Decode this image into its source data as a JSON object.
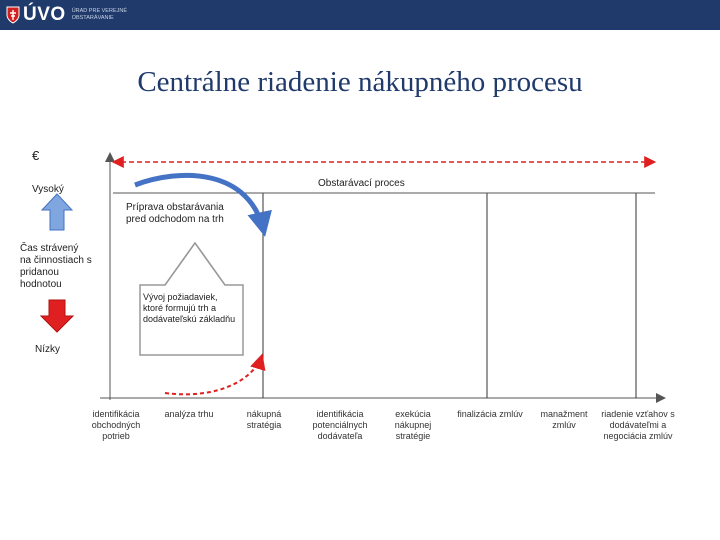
{
  "header": {
    "logo_text": "ÚVO",
    "logo_subtitle": "Úrad pre verejné obstarávanie"
  },
  "title": "Centrálne riadenie nákupného procesu",
  "axis": {
    "euro": "€",
    "high": "Vysoký",
    "low": "Nízky",
    "value_label": "Čas strávený na činnostiach s pridanou hodnotou"
  },
  "process_label": "Obstarávací proces",
  "boxes": {
    "preparation": "Príprava obstarávania pred odchodom na trh",
    "development": "Vývoj požiadaviek, ktoré formujú trh a dodávateľskú základňu"
  },
  "steps": [
    "identifikácia obchodných potrieb",
    "analýza trhu",
    "nákupná stratégia",
    "identifikácia potenciálnych dodávateľa",
    "exekúcia nákupnej stratégie",
    "finalizácia zmlúv",
    "manažment zmlúv",
    "riadenie vzťahov s dodávateľmi a negociácia zmlúv"
  ],
  "colors": {
    "accent_red": "#e02020",
    "accent_blue": "#4472c4",
    "header": "#1f3a6b",
    "title": "#1f3a6b"
  }
}
